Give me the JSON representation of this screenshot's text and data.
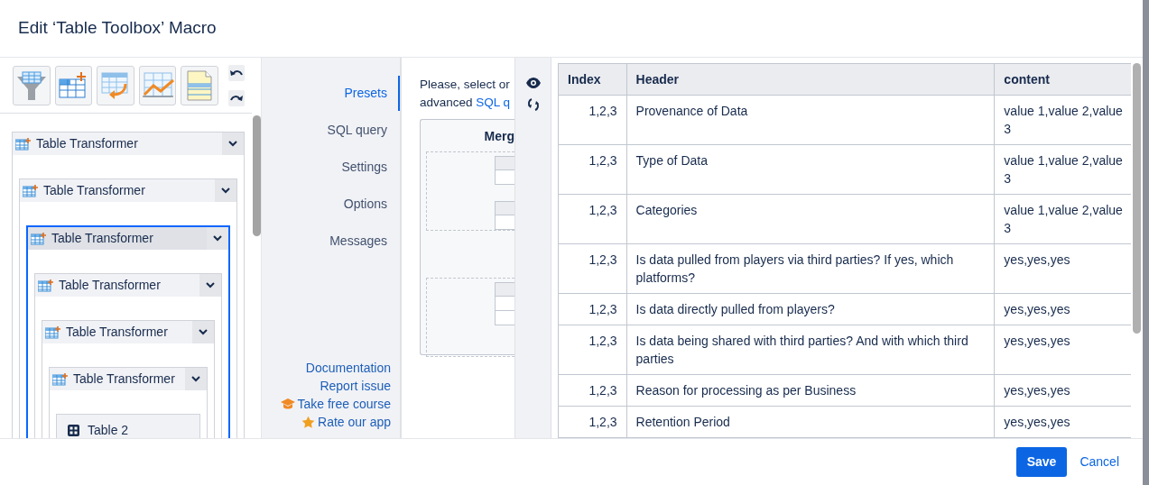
{
  "dialog": {
    "title": "Edit ‘Table Toolbox’ Macro"
  },
  "tree": [
    {
      "label": "Table Transformer",
      "kind": "transformer",
      "selected": false,
      "children": [
        {
          "label": "Table Transformer",
          "kind": "transformer",
          "selected": false,
          "children": [
            {
              "label": "Table Transformer",
              "kind": "transformer",
              "selected": true,
              "children": [
                {
                  "label": "Table Transformer",
                  "kind": "transformer",
                  "selected": false,
                  "children": [
                    {
                      "label": "Table Transformer",
                      "kind": "transformer",
                      "selected": false,
                      "children": [
                        {
                          "label": "Table Transformer",
                          "kind": "transformer",
                          "selected": false,
                          "children": [
                            {
                              "label": "Table 2",
                              "kind": "table",
                              "selected": false
                            }
                          ]
                        }
                      ]
                    }
                  ]
                }
              ]
            }
          ]
        }
      ]
    }
  ],
  "nav": [
    {
      "label": "Presets",
      "selected": true
    },
    {
      "label": "SQL query",
      "selected": false
    },
    {
      "label": "Settings",
      "selected": false
    },
    {
      "label": "Options",
      "selected": false
    },
    {
      "label": "Messages",
      "selected": false
    }
  ],
  "links": [
    {
      "label": "Documentation",
      "kind": "plain"
    },
    {
      "label": "Report issue",
      "kind": "plain"
    },
    {
      "label": "Take free course",
      "kind": "course"
    },
    {
      "label": "Rate our app",
      "kind": "star"
    }
  ],
  "presets": {
    "intro_line_1": "Please, select or",
    "intro_line_2": "advanced",
    "intro_link": "SQL q",
    "card_title": "Merg"
  },
  "table": {
    "columns": [
      "Index",
      "Header",
      "content"
    ],
    "rows": [
      [
        "1,2,3",
        "Provenance of Data",
        "value 1,value 2,value 3"
      ],
      [
        "1,2,3",
        "Type of Data",
        "value 1,value 2,value 3"
      ],
      [
        "1,2,3",
        "Categories",
        "value 1,value 2,value 3"
      ],
      [
        "1,2,3",
        "Is data pulled from players via third parties? If yes, which platforms?",
        "yes,yes,yes"
      ],
      [
        "1,2,3",
        "Is data directly pulled from players?",
        "yes,yes,yes"
      ],
      [
        "1,2,3",
        "Is data being shared with third parties? And with which third parties",
        "yes,yes,yes"
      ],
      [
        "1,2,3",
        "Reason for processing as per Business",
        "yes,yes,yes"
      ],
      [
        "1,2,3",
        "Retention Period",
        "yes,yes,yes"
      ]
    ]
  },
  "buttons": {
    "save": "Save",
    "cancel": "Cancel"
  }
}
